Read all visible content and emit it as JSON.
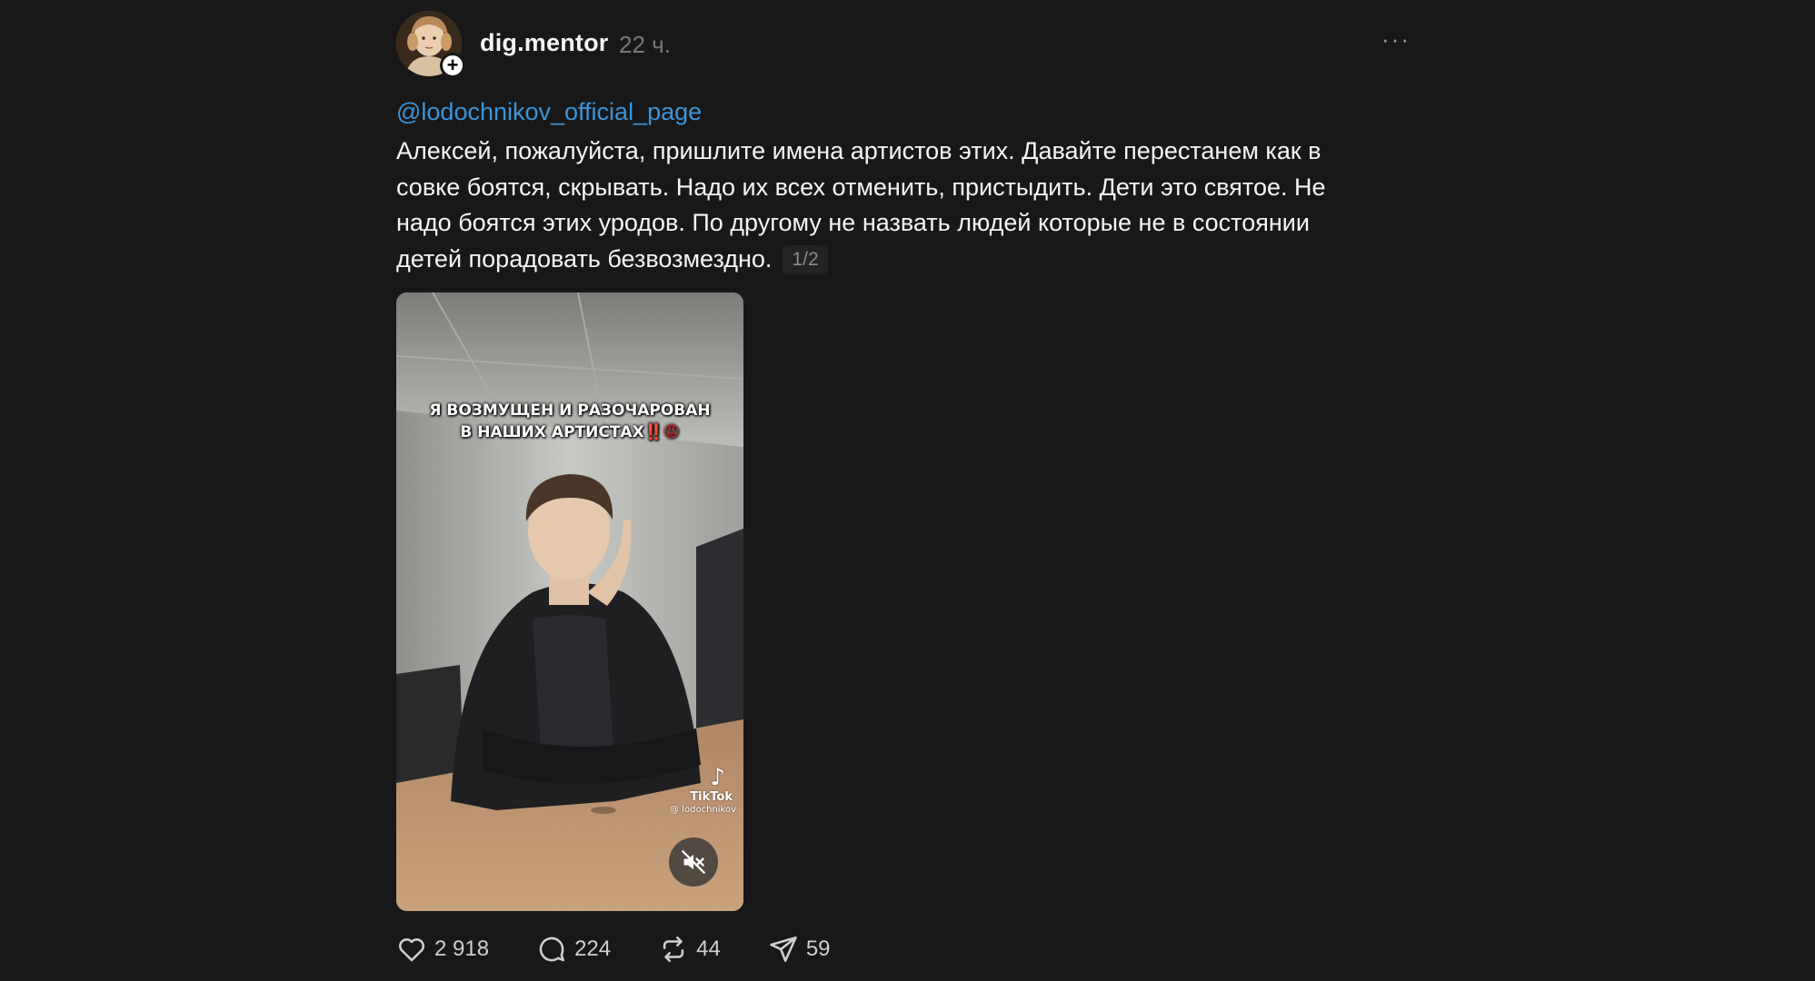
{
  "post": {
    "author": "dig.mentor",
    "time": "22 ч.",
    "more_label": "···",
    "follow_symbol": "+",
    "mention": "@lodochnikov_official_page",
    "text": "Алексей, пожалуйста, пришлите имена артистов этих. Давайте перестанем как в совке боятся, скрывать. Надо их всех отменить, пристыдить. Дети это святое. Не надо боятся этих уродов. По другому не назвать людей которые не в состоянии детей порадовать безвозмездно.",
    "media_counter": "1/2"
  },
  "video": {
    "overlay_line1": "Я ВОЗМУЩЕН И РАЗОЧАРОВАН",
    "overlay_line2": "В НАШИХ АРТИСТАХ",
    "overlay_emoji": "‼️😡",
    "watermark_brand": "TikTok",
    "watermark_handle": "@ lodochnikov",
    "muted": true
  },
  "actions": {
    "likes": "2 918",
    "comments": "224",
    "reposts": "44",
    "shares": "59"
  },
  "icons": {
    "like": "heart-icon",
    "comment": "speech-bubble-icon",
    "repost": "repost-icon",
    "share": "send-icon",
    "mute": "speaker-muted-icon",
    "tiktok": "tiktok-logo-icon",
    "follow": "plus-icon",
    "more": "ellipsis-icon"
  },
  "colors": {
    "background": "#181818",
    "mention": "#3b94d9",
    "text": "#f3f5f7",
    "muted_text": "#777777"
  }
}
